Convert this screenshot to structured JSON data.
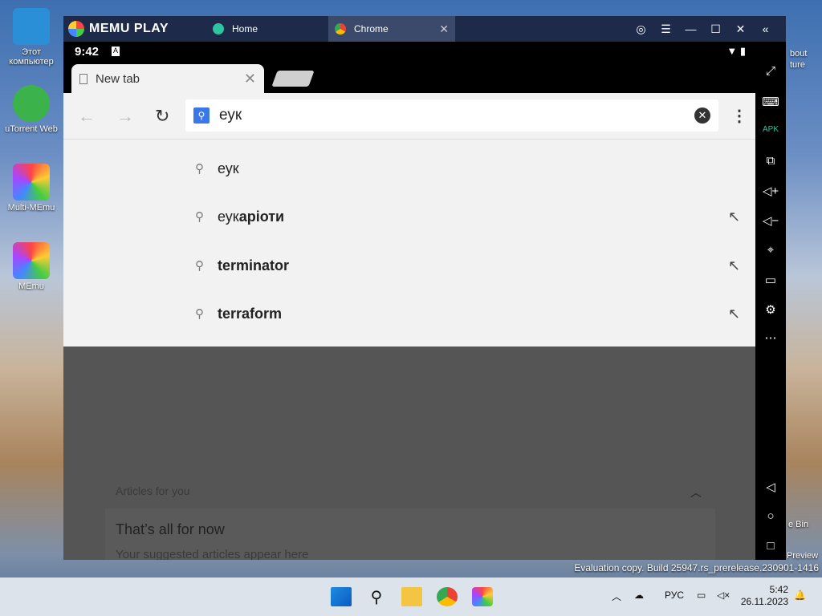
{
  "desktop": {
    "icons": [
      {
        "label": "Этот компьютер"
      },
      {
        "label": "uTorrent Web"
      },
      {
        "label": "Multi-MEmu"
      },
      {
        "label": "MEmu"
      }
    ],
    "right_texts": {
      "about": "bout",
      "ture": "ture",
      "bin": "e Bin",
      "preview": "Preview"
    }
  },
  "memu": {
    "brand": "MEMU PLAY",
    "tabs": [
      {
        "label": "Home"
      },
      {
        "label": "Chrome"
      }
    ]
  },
  "android": {
    "time": "9:42",
    "status_a": "A"
  },
  "chrome": {
    "tab_title": "New tab",
    "omnibox_value": "еук",
    "suggestions": [
      {
        "prefix": "еук",
        "bold": ""
      },
      {
        "prefix": "еук",
        "bold": "аріоти"
      },
      {
        "prefix": "",
        "bold": "terminator"
      },
      {
        "prefix": "",
        "bold": "terraform"
      }
    ],
    "articles_header": "Articles for you",
    "card_title": "That’s all for now",
    "card_subtitle": "Your suggested articles appear here"
  },
  "sidebar_icons": [
    "fullscreen-icon",
    "keyboard-icon",
    "apk-icon",
    "multi-window-icon",
    "volume-up-icon",
    "volume-down-icon",
    "location-icon",
    "folder-icon",
    "settings-icon",
    "more-icon",
    "back-icon",
    "home-icon",
    "recents-icon"
  ],
  "windows": {
    "watermark": "Evaluation copy. Build 25947.rs_prerelease.230901-1416",
    "lang": "РУС",
    "time": "5:42",
    "date": "26.11.2023"
  }
}
